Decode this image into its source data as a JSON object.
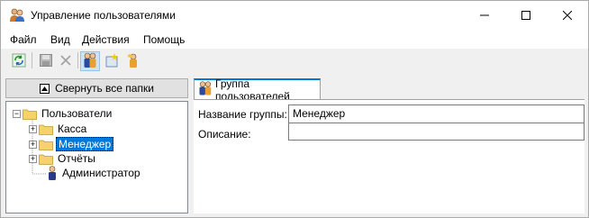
{
  "window": {
    "title": "Управление пользователями",
    "icon": "users-group-icon",
    "controls": [
      "minimize-icon",
      "maximize-icon",
      "close-icon"
    ]
  },
  "menu": {
    "items": [
      "Файл",
      "Вид",
      "Действия",
      "Помощь"
    ]
  },
  "toolbar": {
    "buttons": [
      {
        "icon": "refresh-icon",
        "pressed": false
      },
      {
        "icon": "save-icon",
        "pressed": false,
        "disabled": true
      },
      {
        "icon": "delete-icon",
        "pressed": false,
        "disabled": true
      },
      {
        "icon": "group-users-icon",
        "pressed": true
      },
      {
        "icon": "new-group-icon",
        "pressed": false
      },
      {
        "icon": "new-user-icon",
        "pressed": false
      }
    ]
  },
  "sidebar": {
    "collapse_label": "Свернуть все папки",
    "tree": {
      "root": {
        "label": "Пользователи",
        "expanded": true
      },
      "items": [
        {
          "label": "Касса",
          "type": "folder",
          "expanded": false,
          "selected": false
        },
        {
          "label": "Менеджер",
          "type": "folder",
          "expanded": false,
          "selected": true
        },
        {
          "label": "Отчёты",
          "type": "folder",
          "expanded": false,
          "selected": false
        },
        {
          "label": "Администратор",
          "type": "user",
          "selected": false
        }
      ]
    }
  },
  "details": {
    "tab_label": "Группа пользователей",
    "fields": {
      "group_name_label": "Название группы:",
      "group_name_value": "Менеджер",
      "description_label": "Описание:",
      "description_value": ""
    }
  },
  "colors": {
    "selection": "#0078d7",
    "folder": "#f6d26b",
    "window_bg": "#f0f0f0"
  }
}
